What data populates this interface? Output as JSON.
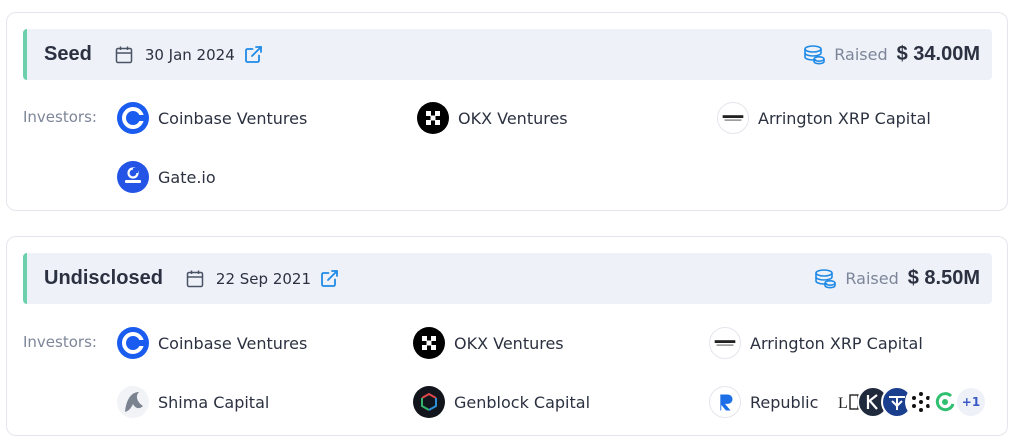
{
  "labels": {
    "investors": "Investors:",
    "raised": "Raised"
  },
  "colors": {
    "accent": "#6cd0ad",
    "header_bg": "#eef1f8",
    "link_blue": "#1f8ae6"
  },
  "rounds": [
    {
      "name": "Seed",
      "date": "30 Jan 2024",
      "amount": "$ 34.00M",
      "investors": [
        {
          "name": "Coinbase Ventures",
          "icon": "coinbase-logo"
        },
        {
          "name": "OKX Ventures",
          "icon": "okx-logo"
        },
        {
          "name": "Arrington XRP Capital",
          "icon": "arrington-logo"
        },
        {
          "name": "Gate.io",
          "icon": "gateio-logo"
        }
      ]
    },
    {
      "name": "Undisclosed",
      "date": "22 Sep 2021",
      "amount": "$ 8.50M",
      "investors": [
        {
          "name": "Coinbase Ventures",
          "icon": "coinbase-logo"
        },
        {
          "name": "OKX Ventures",
          "icon": "okx-logo"
        },
        {
          "name": "Arrington XRP Capital",
          "icon": "arrington-logo"
        },
        {
          "name": "Shima Capital",
          "icon": "shima-logo"
        },
        {
          "name": "Genblock Capital",
          "icon": "genblock-logo"
        },
        {
          "name": "Republic",
          "icon": "republic-logo"
        }
      ],
      "more_logos": [
        "lb-logo",
        "kronos-logo",
        "fenbushi-logo",
        "dots-logo",
        "green-swirl-logo"
      ],
      "more_count": "+1"
    }
  ]
}
